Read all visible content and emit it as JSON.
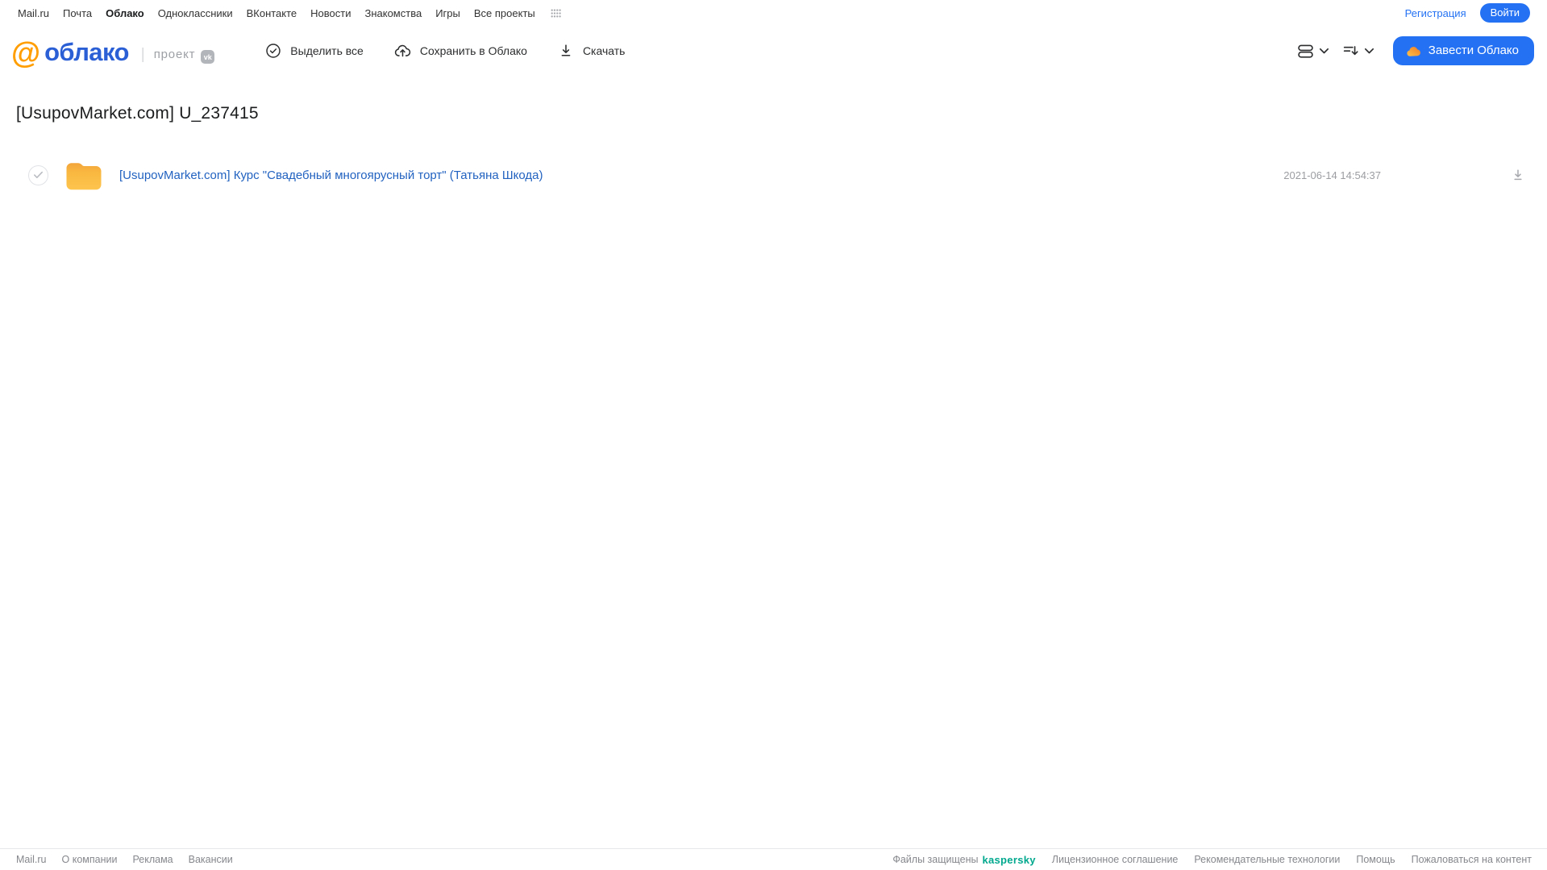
{
  "colors": {
    "accent_blue": "#2472f3",
    "logo_blue": "#2a5fd6",
    "logo_orange": "#ff9e00",
    "file_link_blue": "#2262c0",
    "kaspersky_green": "#00a88e",
    "folder_top": "#f3a43a",
    "folder_mid": "#f9b840",
    "folder_bottom": "#fdc44e",
    "cloud_icon_light": "#fdc24a",
    "cloud_icon_dark": "#f07b23"
  },
  "top_nav": {
    "items": [
      "Mail.ru",
      "Почта",
      "Облако",
      "Одноклассники",
      "ВКонтакте",
      "Новости",
      "Знакомства",
      "Игры",
      "Все проекты"
    ],
    "active_item": "Облако",
    "register_label": "Регистрация",
    "login_label": "Войти"
  },
  "header": {
    "logo_at": "@",
    "logo_text": "облако",
    "divider": "|",
    "project_label": "проект",
    "vk_badge_label": "vk",
    "toolbar": {
      "select_all": "Выделить все",
      "save_to_cloud": "Сохранить в Облако",
      "download": "Скачать"
    },
    "get_cloud_button": "Завести Облако"
  },
  "main": {
    "title": "[UsupovMarket.com] U_237415",
    "files": [
      {
        "type": "folder",
        "name": "[UsupovMarket.com] Курс \"Свадебный многоярусный торт\" (Татьяна Шкода)",
        "modified": "2021-06-14 14:54:37"
      }
    ]
  },
  "footer": {
    "left_links": [
      "Mail.ru",
      "О компании",
      "Реклама",
      "Вакансии"
    ],
    "protected_label": "Файлы защищены",
    "kaspersky_label": "kaspersky",
    "right_links": [
      "Лицензионное соглашение",
      "Рекомендательные технологии",
      "Помощь",
      "Пожаловаться на контент"
    ]
  }
}
